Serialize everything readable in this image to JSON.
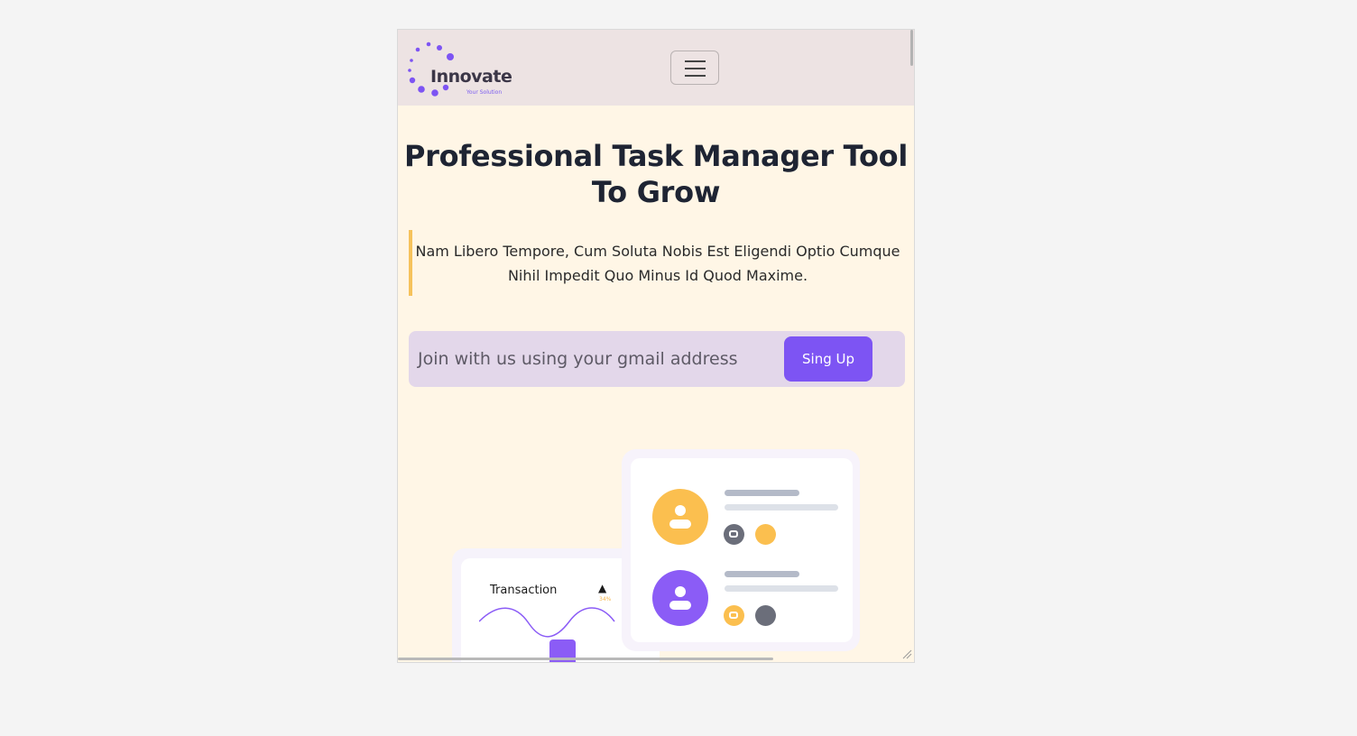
{
  "brand": {
    "name": "Innovate",
    "tagline": "Your Solution",
    "accent_color": "#7d54f3"
  },
  "navbar": {
    "menu_icon": "hamburger-menu-icon"
  },
  "hero": {
    "title": "Professional Task Manager Tool To Grow",
    "quote": "Nam Libero Tempore, Cum Soluta Nobis Est Eligendi Optio Cumque Nihil Impedit Quo Minus Id Quod Maxime."
  },
  "signup": {
    "placeholder": "Join with us using your gmail address",
    "button_label": "Sing Up"
  },
  "illustration": {
    "transaction_label": "Transaction",
    "transaction_percent": "34%",
    "colors": {
      "yellow": "#fbbf4f",
      "purple": "#8b5cf6",
      "gray": "#6b6e7a"
    }
  }
}
